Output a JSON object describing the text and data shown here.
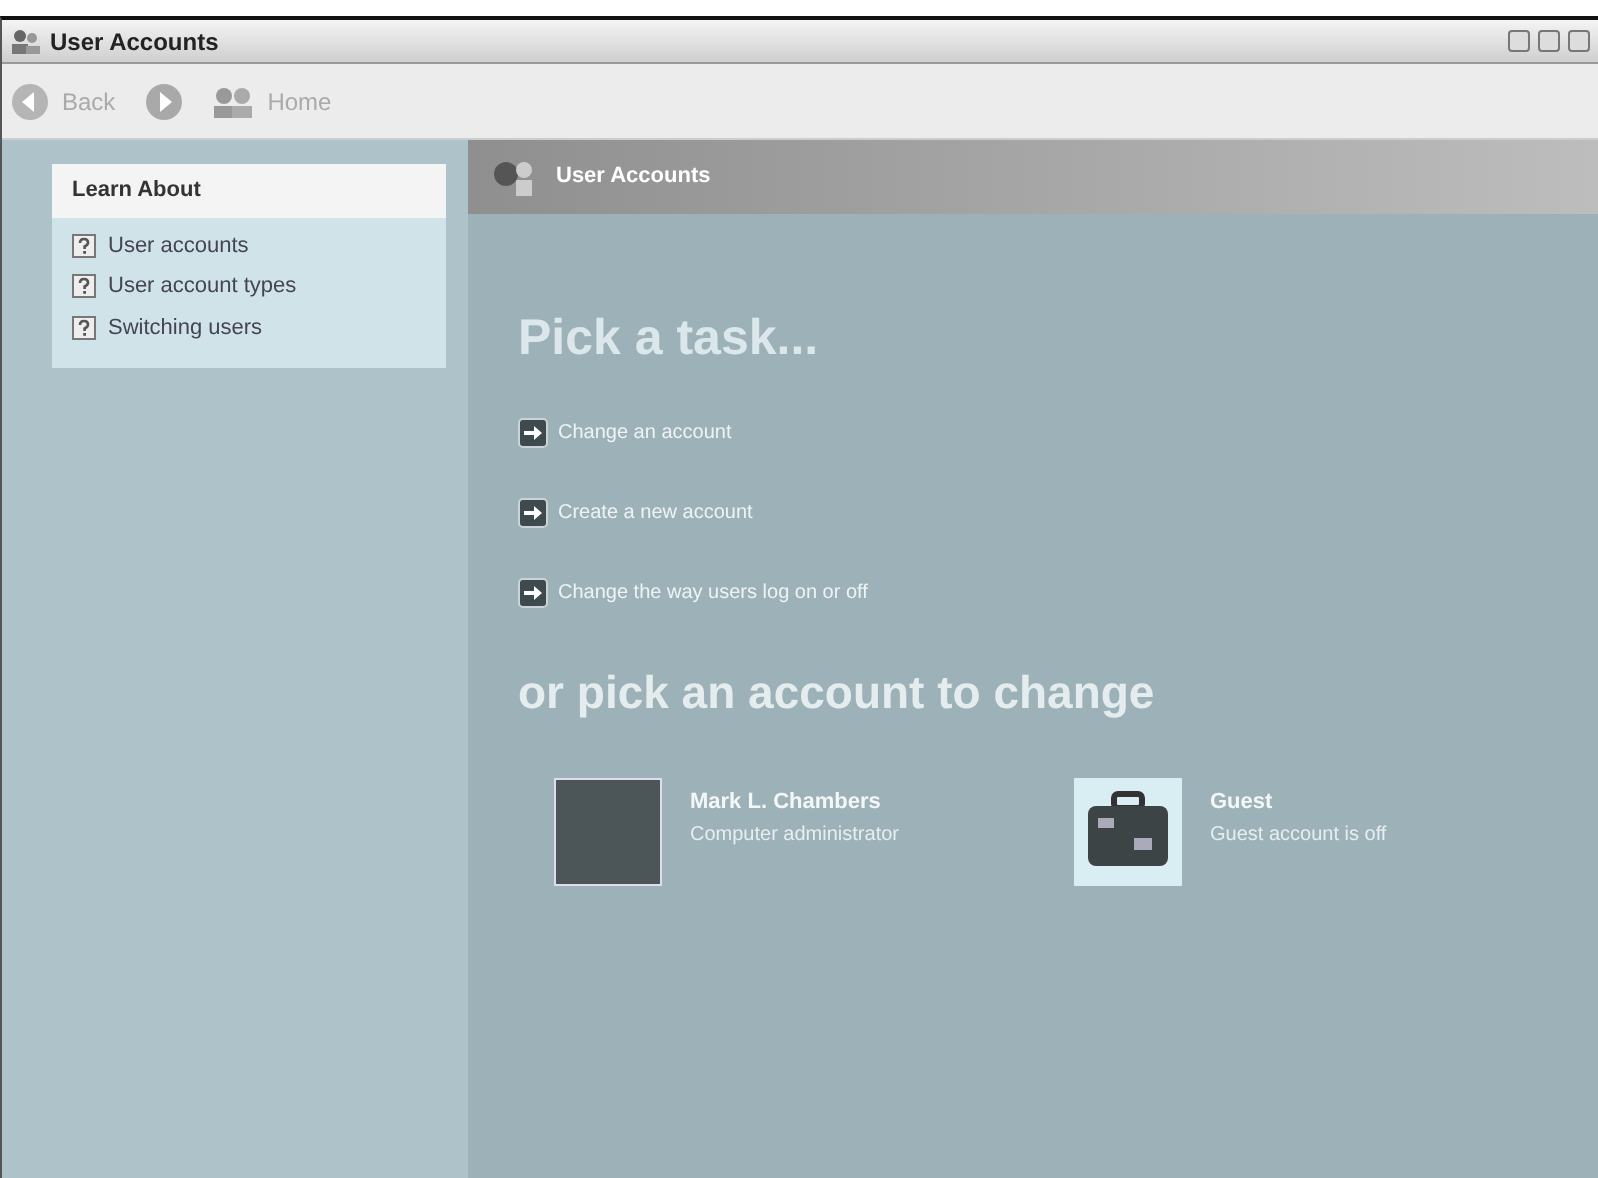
{
  "window": {
    "title": "User Accounts"
  },
  "toolbar": {
    "back": "Back",
    "home": "Home"
  },
  "learn_about": {
    "title": "Learn About",
    "items": [
      "User accounts",
      "User account types",
      "Switching users"
    ]
  },
  "header": {
    "title": "User Accounts"
  },
  "task_heading": "Pick a task...",
  "tasks": [
    "Change an account",
    "Create a new account",
    "Change the way users log on or off"
  ],
  "account_heading": "or pick an account to change",
  "accounts": [
    {
      "kind": "photo",
      "name": "Mark L. Chambers",
      "description": "Computer administrator"
    },
    {
      "kind": "suitcase",
      "name": "Guest",
      "description": "Guest account is off"
    }
  ]
}
